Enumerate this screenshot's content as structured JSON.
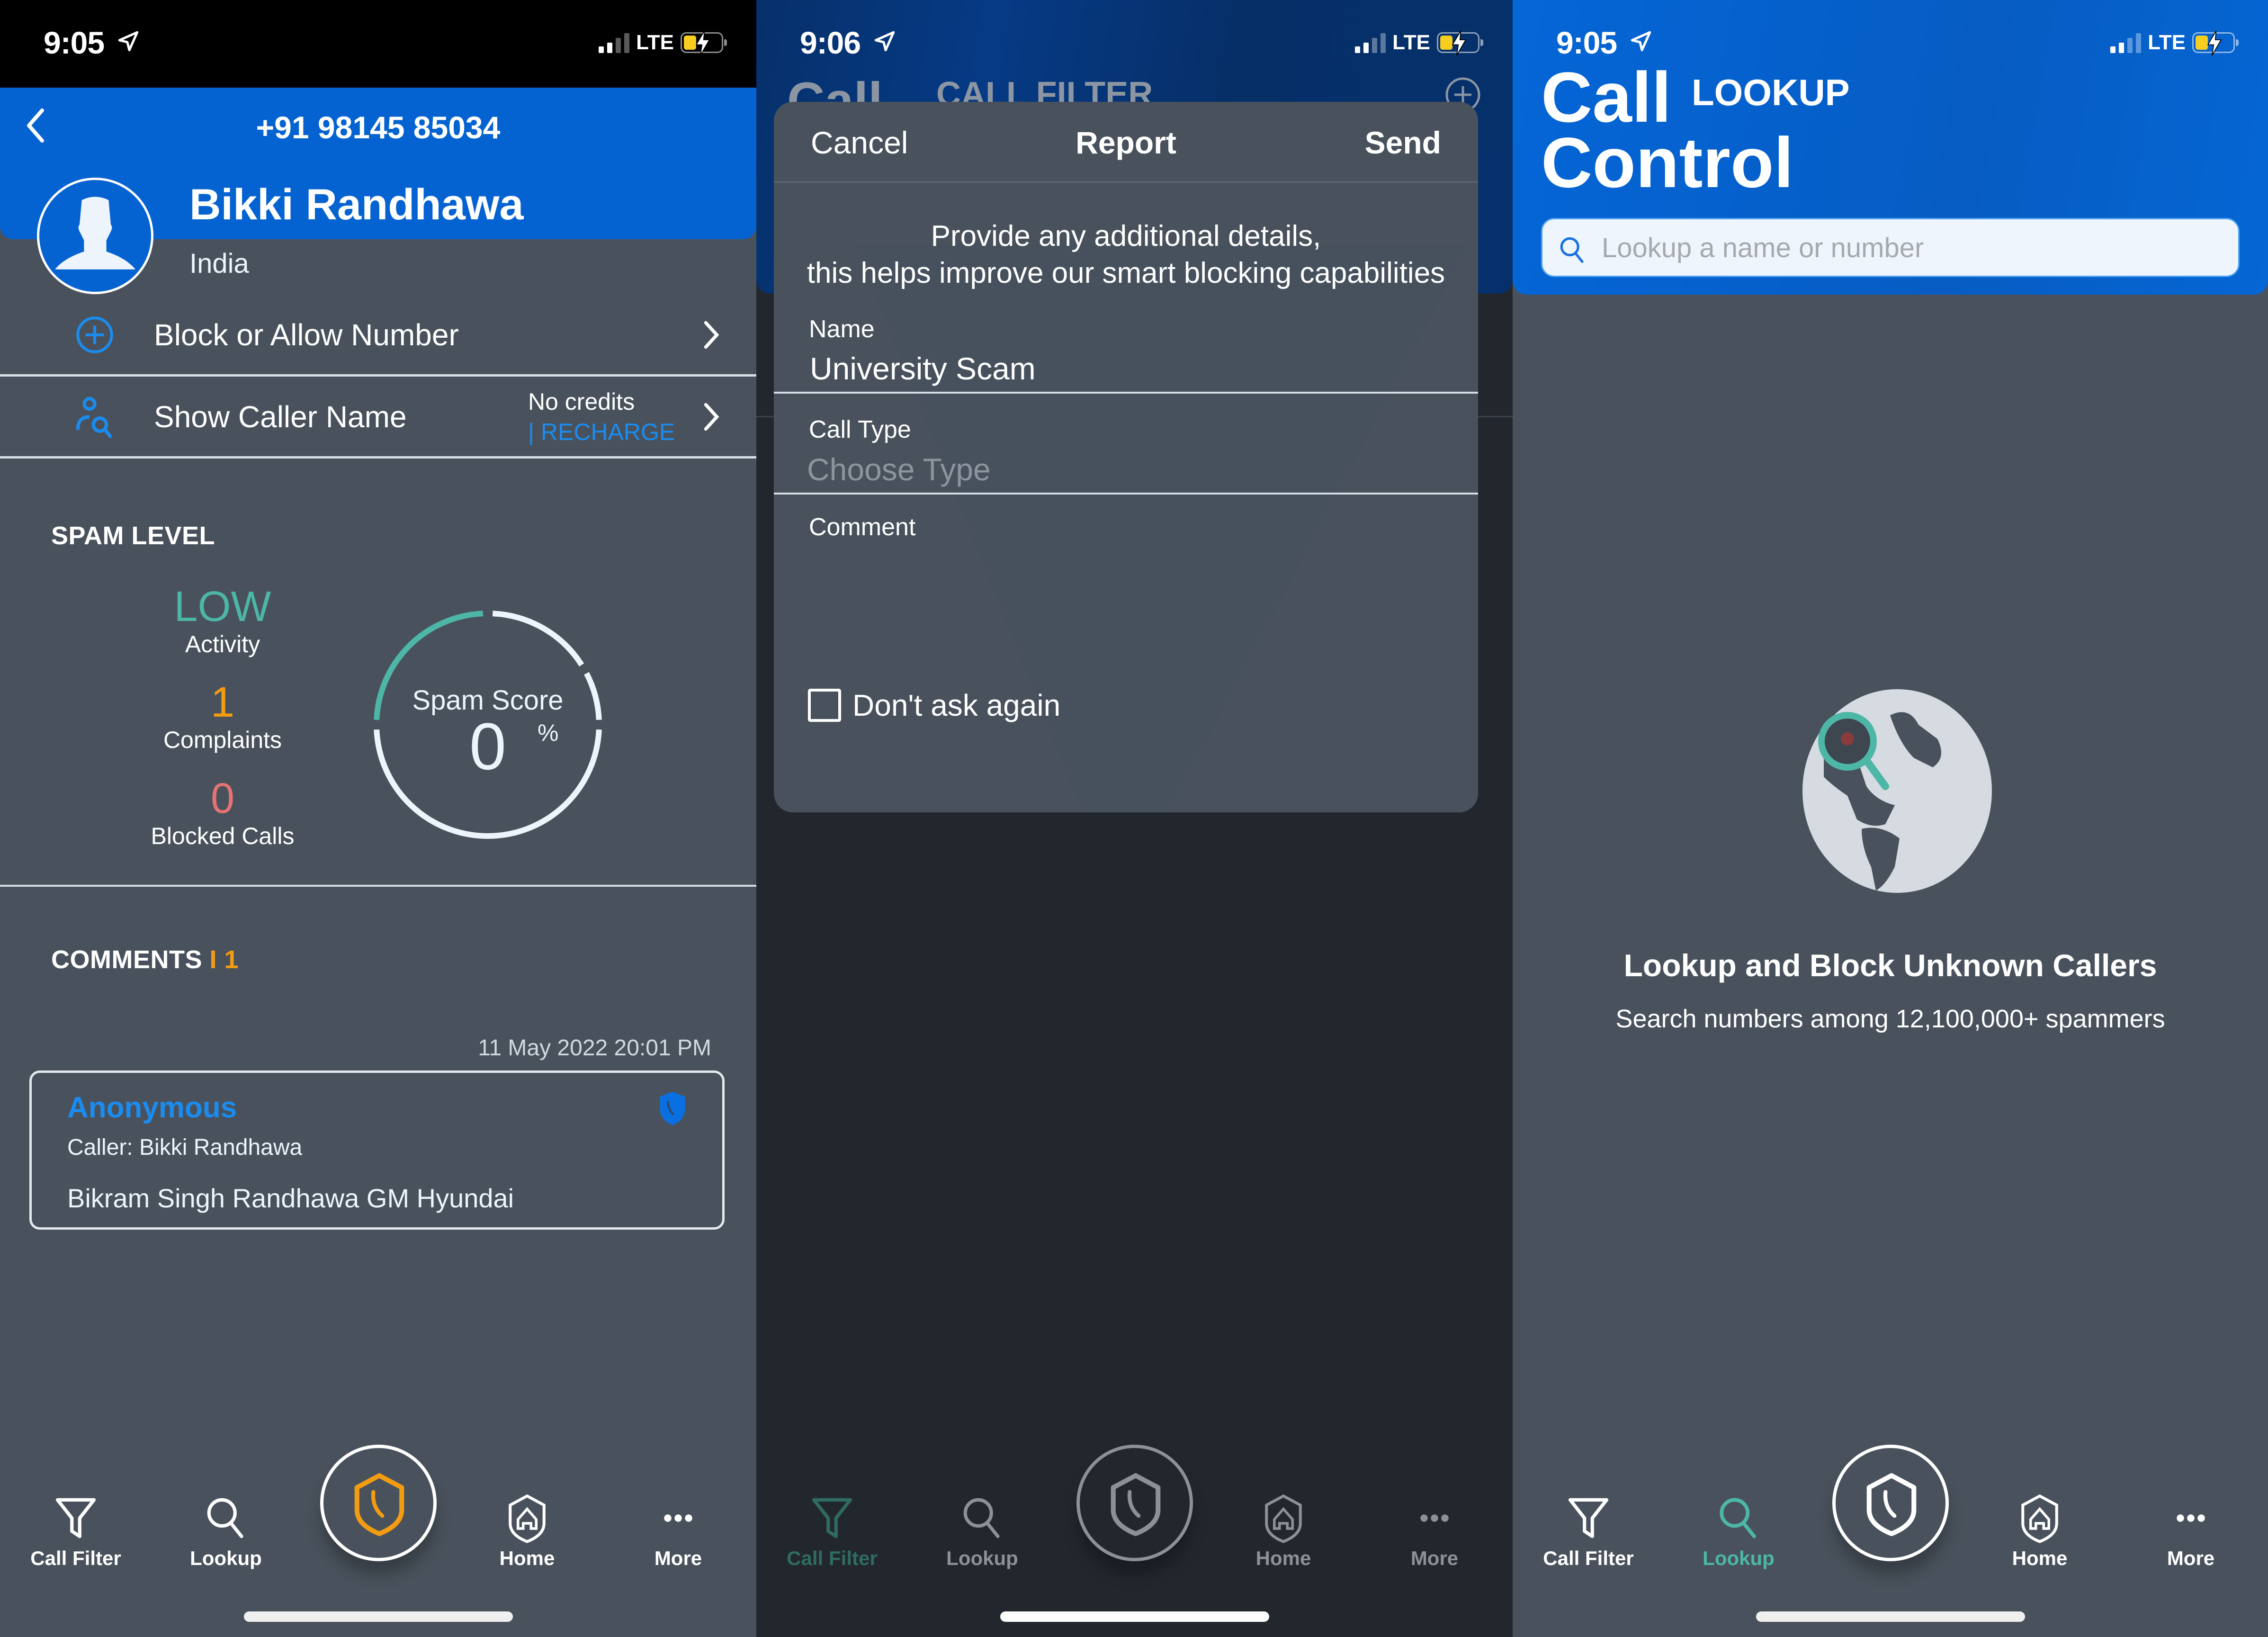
{
  "colors": {
    "brand_blue": "#0563d1",
    "accent_teal": "#4db6a6",
    "accent_orange": "#f39c12",
    "accent_red": "#e57373",
    "link_blue": "#1a8cf0",
    "surface": "#49525c",
    "dim_surface": "#22272e"
  },
  "screens": [
    {
      "status": {
        "time": "9:05",
        "network": "LTE"
      },
      "header": {
        "phone_number": "+91 98145 85034",
        "caller_name": "Bikki Randhawa",
        "country": "India"
      },
      "actions": [
        {
          "label": "Block or  Allow Number",
          "icon": "plus-circle-icon"
        },
        {
          "label": "Show Caller Name",
          "icon": "person-search-icon",
          "credits_text": "No credits",
          "recharge_label": "| RECHARGE"
        }
      ],
      "spam_level": {
        "title": "SPAM LEVEL",
        "activity_value": "LOW",
        "activity_label": "Activity",
        "complaints_value": "1",
        "complaints_label": "Complaints",
        "blocked_value": "0",
        "blocked_label": "Blocked Calls",
        "gauge_title": "Spam Score",
        "gauge_value": "0",
        "gauge_unit": "%",
        "gauge_score_percent": 0
      },
      "comments": {
        "title": "COMMENTS",
        "separator": "I",
        "count": "1",
        "items": [
          {
            "timestamp": "11 May 2022 20:01 PM",
            "author": "Anonymous",
            "caller": "Caller: Bikki Randhawa",
            "text": "Bikram Singh Randhawa GM Hyundai"
          }
        ]
      },
      "tabs": [
        {
          "label": "Call Filter",
          "icon": "filter-icon"
        },
        {
          "label": "Lookup",
          "icon": "search-icon"
        },
        {
          "label": "Home",
          "icon": "shield-home-icon"
        },
        {
          "label": "More",
          "icon": "more-icon"
        }
      ],
      "active_tab": "center"
    },
    {
      "status": {
        "time": "9:06",
        "network": "LTE"
      },
      "background": {
        "title": "Call",
        "subtitle": "CALL FILTER"
      },
      "modal": {
        "cancel_label": "Cancel",
        "title": "Report",
        "send_label": "Send",
        "info_line1": "Provide any additional details,",
        "info_line2": "this helps improve our smart blocking capabilities",
        "name_label": "Name",
        "name_value": "University Scam",
        "call_type_label": "Call Type",
        "call_type_placeholder": "Choose Type",
        "comment_label": "Comment",
        "comment_value": "",
        "dont_ask_label": "Don't ask again",
        "dont_ask_checked": false
      },
      "tabs": [
        {
          "label": "Call Filter",
          "icon": "filter-icon"
        },
        {
          "label": "Lookup",
          "icon": "search-icon"
        },
        {
          "label": "Home",
          "icon": "shield-home-icon"
        },
        {
          "label": "More",
          "icon": "more-icon"
        }
      ],
      "active_tab": "Call Filter"
    },
    {
      "status": {
        "time": "9:05",
        "network": "LTE"
      },
      "header": {
        "brand_line1": "Call",
        "brand_line2": "Control",
        "section": "LOOKUP"
      },
      "search": {
        "placeholder": "Lookup a name or number",
        "value": ""
      },
      "empty_state": {
        "title": "Lookup and Block Unknown Callers",
        "subtitle": "Search numbers among 12,100,000+ spammers"
      },
      "tabs": [
        {
          "label": "Call Filter",
          "icon": "filter-icon"
        },
        {
          "label": "Lookup",
          "icon": "search-icon"
        },
        {
          "label": "Home",
          "icon": "shield-home-icon"
        },
        {
          "label": "More",
          "icon": "more-icon"
        }
      ],
      "active_tab": "Lookup"
    }
  ]
}
